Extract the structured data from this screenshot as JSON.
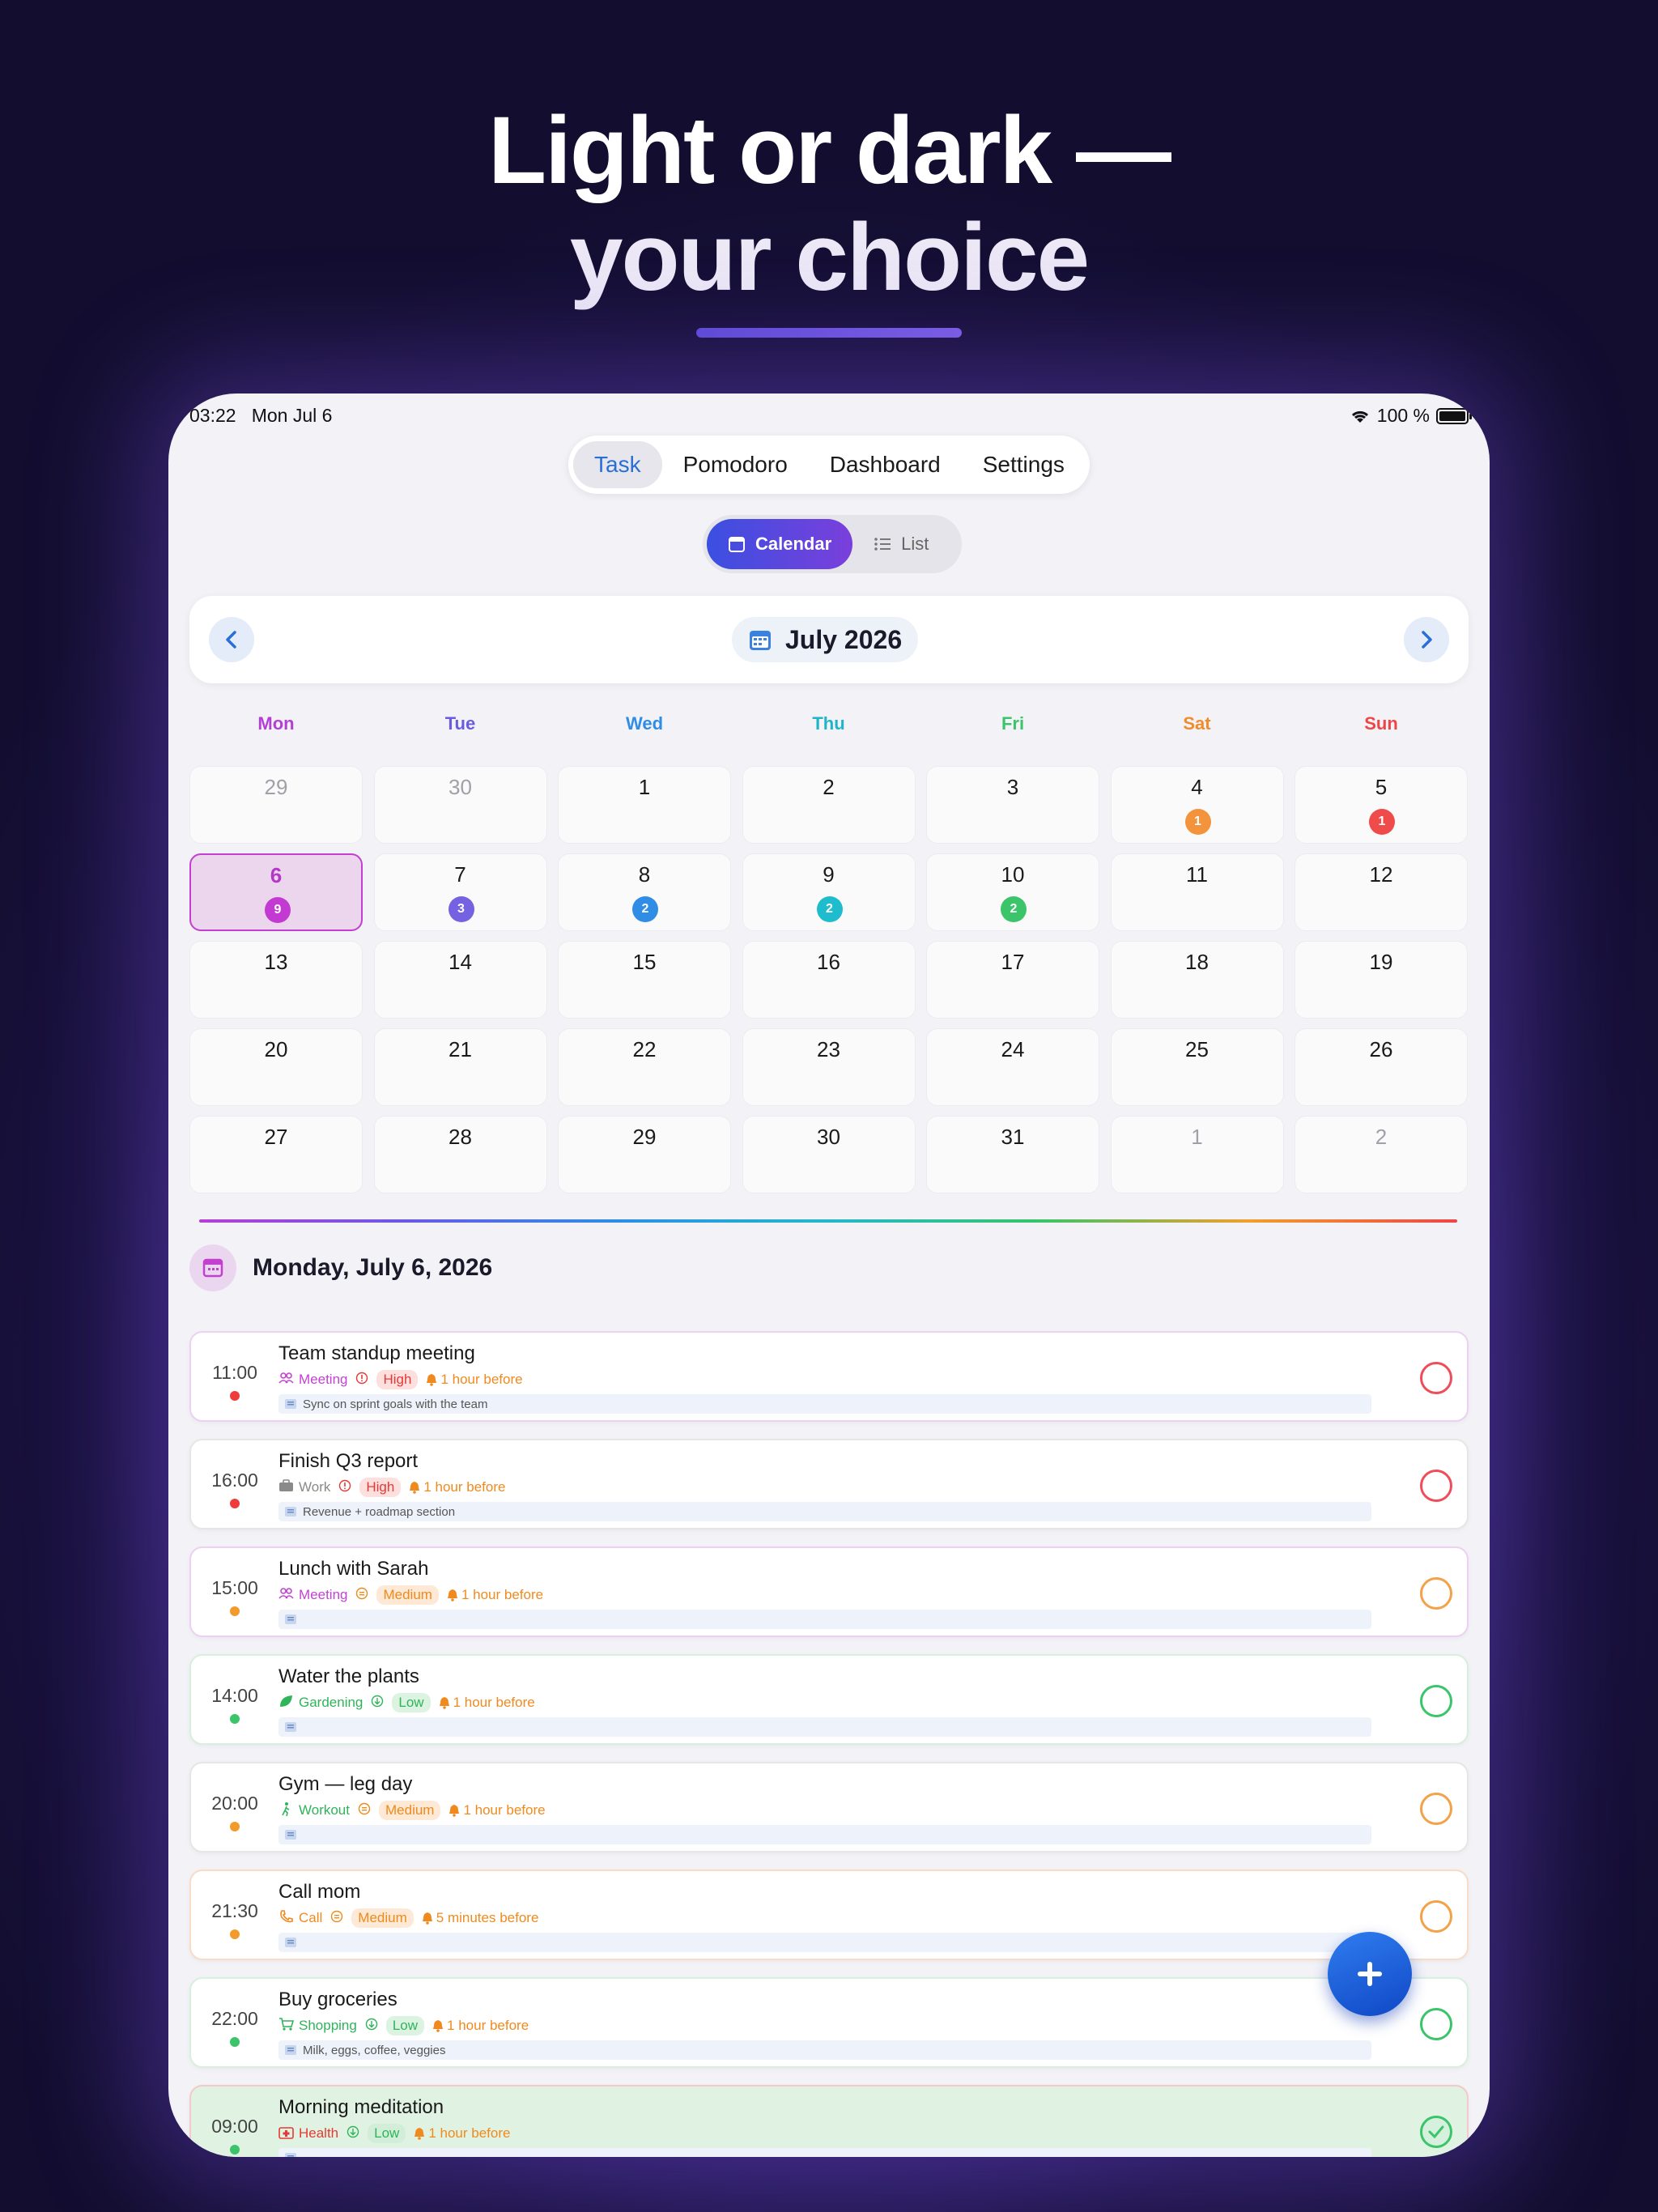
{
  "headline": {
    "line1": "Light or dark —",
    "line2": "your choice"
  },
  "status": {
    "time": "03:22",
    "date": "Mon Jul 6",
    "battery": "100 %"
  },
  "topnav": {
    "tabs": [
      {
        "label": "Task",
        "active": true
      },
      {
        "label": "Pomodoro",
        "active": false
      },
      {
        "label": "Dashboard",
        "active": false
      },
      {
        "label": "Settings",
        "active": false
      }
    ]
  },
  "view": {
    "calendar": "Calendar",
    "list": "List",
    "selected": "Calendar"
  },
  "month": {
    "title": "July 2026",
    "prev_icon": "chevron-left-icon",
    "next_icon": "chevron-right-icon"
  },
  "weekdays": [
    {
      "label": "Mon",
      "color": "#b53fd4"
    },
    {
      "label": "Tue",
      "color": "#6b5be0"
    },
    {
      "label": "Wed",
      "color": "#2f8de6"
    },
    {
      "label": "Thu",
      "color": "#1fb5c9"
    },
    {
      "label": "Fri",
      "color": "#3bc46a"
    },
    {
      "label": "Sat",
      "color": "#f08c2c"
    },
    {
      "label": "Sun",
      "color": "#ee4646"
    }
  ],
  "calendar": {
    "weeks": [
      [
        {
          "d": "29",
          "other": true
        },
        {
          "d": "30",
          "other": true
        },
        {
          "d": "1"
        },
        {
          "d": "2"
        },
        {
          "d": "3"
        },
        {
          "d": "4",
          "badge": "1",
          "badge_color": "#f3943c"
        },
        {
          "d": "5",
          "badge": "1",
          "badge_color": "#ef4b4b"
        }
      ],
      [
        {
          "d": "6",
          "today": true,
          "badge": "9",
          "badge_color": "#c33ad2"
        },
        {
          "d": "7",
          "badge": "3",
          "badge_color": "#7562e2"
        },
        {
          "d": "8",
          "badge": "2",
          "badge_color": "#2f8de6"
        },
        {
          "d": "9",
          "badge": "2",
          "badge_color": "#1fbccd"
        },
        {
          "d": "10",
          "badge": "2",
          "badge_color": "#3bc46a"
        },
        {
          "d": "11"
        },
        {
          "d": "12"
        }
      ],
      [
        {
          "d": "13"
        },
        {
          "d": "14"
        },
        {
          "d": "15"
        },
        {
          "d": "16"
        },
        {
          "d": "17"
        },
        {
          "d": "18"
        },
        {
          "d": "19"
        }
      ],
      [
        {
          "d": "20"
        },
        {
          "d": "21"
        },
        {
          "d": "22"
        },
        {
          "d": "23"
        },
        {
          "d": "24"
        },
        {
          "d": "25"
        },
        {
          "d": "26"
        }
      ],
      [
        {
          "d": "27"
        },
        {
          "d": "28"
        },
        {
          "d": "29"
        },
        {
          "d": "30"
        },
        {
          "d": "31"
        },
        {
          "d": "1",
          "other": true
        },
        {
          "d": "2",
          "other": true
        }
      ]
    ]
  },
  "day_header": "Monday, July 6, 2026",
  "tasks": [
    {
      "time": "11:00",
      "dot": "#ef3b3b",
      "title": "Team standup meeting",
      "category": "Meeting",
      "category_icon": "people-icon",
      "category_color": "#c341d4",
      "priority": "High",
      "priority_color": "#e53935",
      "priority_bg": "#fde0de",
      "reminder": "1 hour before",
      "notes": "Sync on sprint goals with the team",
      "check_color": "#ef4d5a",
      "border": "#ecd2f0",
      "done": false
    },
    {
      "time": "16:00",
      "dot": "#ef3b3b",
      "title": "Finish Q3 report",
      "category": "Work",
      "category_icon": "briefcase-icon",
      "category_color": "#8a8a8a",
      "priority": "High",
      "priority_color": "#e53935",
      "priority_bg": "#fde0de",
      "reminder": "1 hour before",
      "notes": "Revenue + roadmap section",
      "check_color": "#ef4d5a",
      "border": "#e6e6e6",
      "done": false
    },
    {
      "time": "15:00",
      "dot": "#f39a2c",
      "title": "Lunch with Sarah",
      "category": "Meeting",
      "category_icon": "people-icon",
      "category_color": "#c341d4",
      "priority": "Medium",
      "priority_color": "#ef8a1a",
      "priority_bg": "#fde9d6",
      "reminder": "1 hour before",
      "notes": "",
      "check_color": "#f3a24a",
      "border": "#ecd2f0",
      "done": false
    },
    {
      "time": "14:00",
      "dot": "#3bc46a",
      "title": "Water the plants",
      "category": "Gardening",
      "category_icon": "leaf-icon",
      "category_color": "#2fb45a",
      "priority": "Low",
      "priority_color": "#2fb45a",
      "priority_bg": "#dcf3e2",
      "reminder": "1 hour before",
      "notes": "",
      "check_color": "#3bc46a",
      "border": "#d9efde",
      "done": false
    },
    {
      "time": "20:00",
      "dot": "#f39a2c",
      "title": "Gym — leg day",
      "category": "Workout",
      "category_icon": "walk-icon",
      "category_color": "#2fb45a",
      "priority": "Medium",
      "priority_color": "#ef8a1a",
      "priority_bg": "#fde9d6",
      "reminder": "1 hour before",
      "notes": "",
      "check_color": "#f3a24a",
      "border": "#e6e6e6",
      "done": false
    },
    {
      "time": "21:30",
      "dot": "#f39a2c",
      "title": "Call mom",
      "category": "Call",
      "category_icon": "phone-icon",
      "category_color": "#f08a1e",
      "priority": "Medium",
      "priority_color": "#ef8a1a",
      "priority_bg": "#fde9d6",
      "reminder": "5 minutes before",
      "notes": "",
      "check_color": "#f3a24a",
      "border": "#f8dcc8",
      "done": false
    },
    {
      "time": "22:00",
      "dot": "#3bc46a",
      "title": "Buy groceries",
      "category": "Shopping",
      "category_icon": "cart-icon",
      "category_color": "#2fb45a",
      "priority": "Low",
      "priority_color": "#2fb45a",
      "priority_bg": "#dcf3e2",
      "reminder": "1 hour before",
      "notes": "Milk, eggs, coffee, veggies",
      "check_color": "#3bc46a",
      "border": "#d9efde",
      "done": false
    },
    {
      "time": "09:00",
      "dot": "#3bc46a",
      "title": "Morning meditation",
      "category": "Health",
      "category_icon": "medkit-icon",
      "category_color": "#e53935",
      "priority": "Low",
      "priority_color": "#2fb45a",
      "priority_bg": "#d2eed8",
      "reminder": "1 hour before",
      "notes": "",
      "check_color": "#3bc46a",
      "border": "#f3c9c9",
      "done": true
    }
  ],
  "fab_icon": "plus-icon"
}
